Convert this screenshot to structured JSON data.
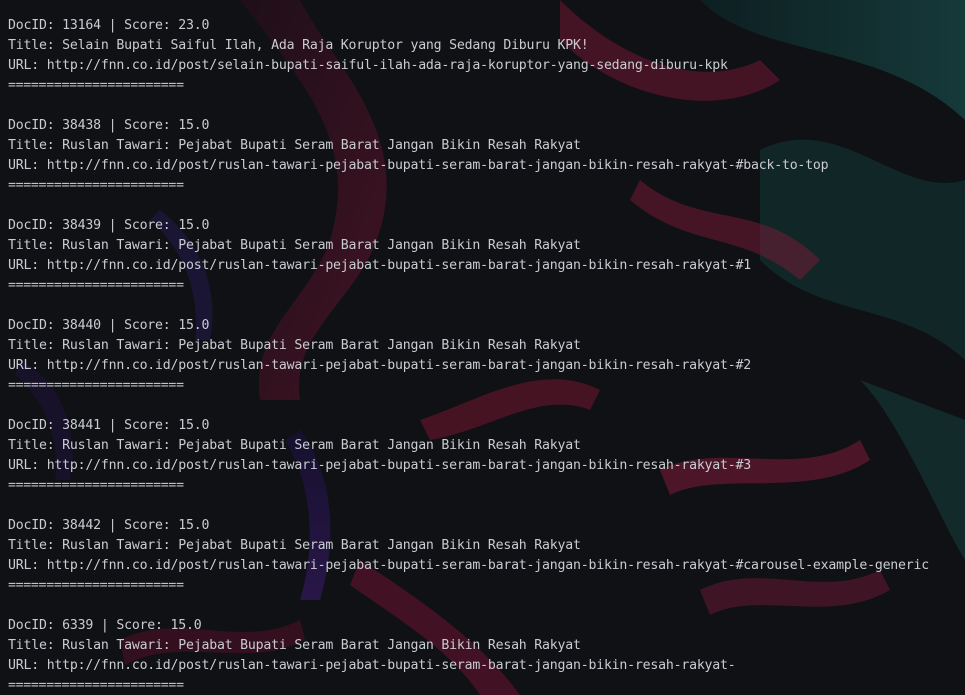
{
  "theme": {
    "background": "#0f1114",
    "text": "#c9ccd1"
  },
  "results": [
    {
      "header": "DocID: 13164 | Score: 23.0",
      "title": "Title: Selain Bupati Saiful Ilah, Ada Raja Koruptor yang Sedang Diburu KPK!",
      "url": "URL: http://fnn.co.id/post/selain-bupati-saiful-ilah-ada-raja-koruptor-yang-sedang-diburu-kpk",
      "separator": "======================="
    },
    {
      "header": "DocID: 38438 | Score: 15.0",
      "title": "Title: Ruslan Tawari: Pejabat Bupati Seram Barat Jangan Bikin Resah Rakyat",
      "url": "URL: http://fnn.co.id/post/ruslan-tawari-pejabat-bupati-seram-barat-jangan-bikin-resah-rakyat-#back-to-top",
      "separator": "======================="
    },
    {
      "header": "DocID: 38439 | Score: 15.0",
      "title": "Title: Ruslan Tawari: Pejabat Bupati Seram Barat Jangan Bikin Resah Rakyat",
      "url": "URL: http://fnn.co.id/post/ruslan-tawari-pejabat-bupati-seram-barat-jangan-bikin-resah-rakyat-#1",
      "separator": "======================="
    },
    {
      "header": "DocID: 38440 | Score: 15.0",
      "title": "Title: Ruslan Tawari: Pejabat Bupati Seram Barat Jangan Bikin Resah Rakyat",
      "url": "URL: http://fnn.co.id/post/ruslan-tawari-pejabat-bupati-seram-barat-jangan-bikin-resah-rakyat-#2",
      "separator": "======================="
    },
    {
      "header": "DocID: 38441 | Score: 15.0",
      "title": "Title: Ruslan Tawari: Pejabat Bupati Seram Barat Jangan Bikin Resah Rakyat",
      "url": "URL: http://fnn.co.id/post/ruslan-tawari-pejabat-bupati-seram-barat-jangan-bikin-resah-rakyat-#3",
      "separator": "======================="
    },
    {
      "header": "DocID: 38442 | Score: 15.0",
      "title": "Title: Ruslan Tawari: Pejabat Bupati Seram Barat Jangan Bikin Resah Rakyat",
      "url": "URL: http://fnn.co.id/post/ruslan-tawari-pejabat-bupati-seram-barat-jangan-bikin-resah-rakyat-#carousel-example-generic",
      "separator": "======================="
    },
    {
      "header": "DocID: 6339 | Score: 15.0",
      "title": "Title: Ruslan Tawari: Pejabat Bupati Seram Barat Jangan Bikin Resah Rakyat",
      "url": "URL: http://fnn.co.id/post/ruslan-tawari-pejabat-bupati-seram-barat-jangan-bikin-resah-rakyat-",
      "separator": "======================="
    }
  ]
}
